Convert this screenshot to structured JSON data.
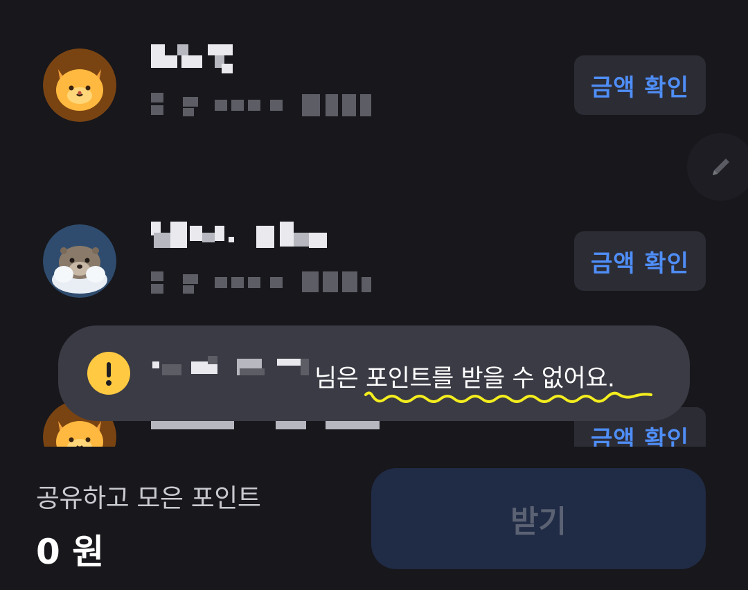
{
  "list": {
    "items": [
      {
        "button_label": "금액 확인",
        "avatar": "cat-avatar-icon"
      },
      {
        "button_label": "금액 확인",
        "avatar": "otter-avatar-icon"
      },
      {
        "button_label": "금액 확인",
        "avatar": "cat-avatar-icon"
      }
    ]
  },
  "edit_button": {
    "icon": "pencil-icon"
  },
  "toast": {
    "message": "님은 포인트를 받을 수 없어요.",
    "icon": "warning-icon",
    "icon_color": "#ffc942",
    "annotation_color": "#f4ee1e"
  },
  "bottom": {
    "points_label": "공유하고 모은 포인트",
    "points_value": "0 원",
    "receive_label": "받기"
  },
  "colors": {
    "background": "#17171c",
    "accent": "#4f8ef7",
    "button_bg": "#2c2c35",
    "receive_bg": "#202b45"
  }
}
